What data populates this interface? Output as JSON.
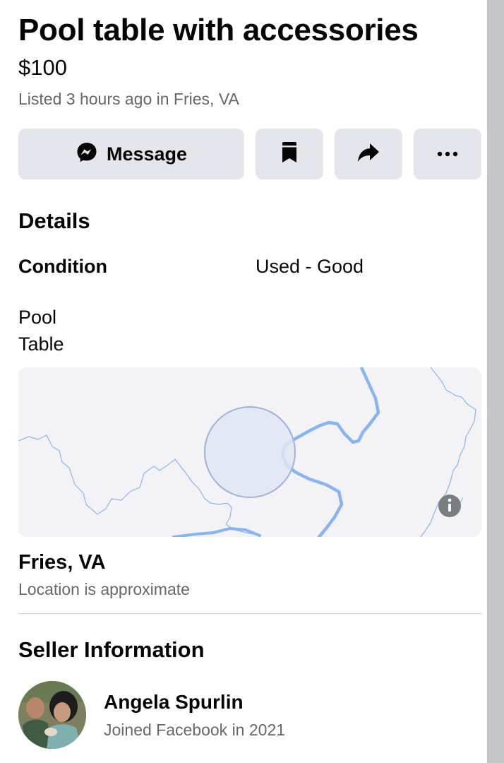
{
  "listing": {
    "title": "Pool table with accessories",
    "price": "$100",
    "listed": "Listed 3 hours ago in Fries, VA"
  },
  "actions": {
    "message_label": "Message",
    "save_icon": "bookmark-icon",
    "share_icon": "share-arrow-icon",
    "more_icon": "more-dots-icon"
  },
  "details": {
    "heading": "Details",
    "condition_label": "Condition",
    "condition_value": "Used - Good",
    "description_line1": "Pool",
    "description_line2": "Table"
  },
  "location": {
    "name": "Fries, VA",
    "note": "Location is approximate"
  },
  "seller": {
    "heading": "Seller Information",
    "name": "Angela Spurlin",
    "joined": "Joined Facebook in 2021"
  },
  "colors": {
    "button_bg": "#e4e6eb",
    "secondary_text": "#65676b",
    "map_water": "#8ab4f0",
    "map_circle": "#a8b8e0"
  }
}
